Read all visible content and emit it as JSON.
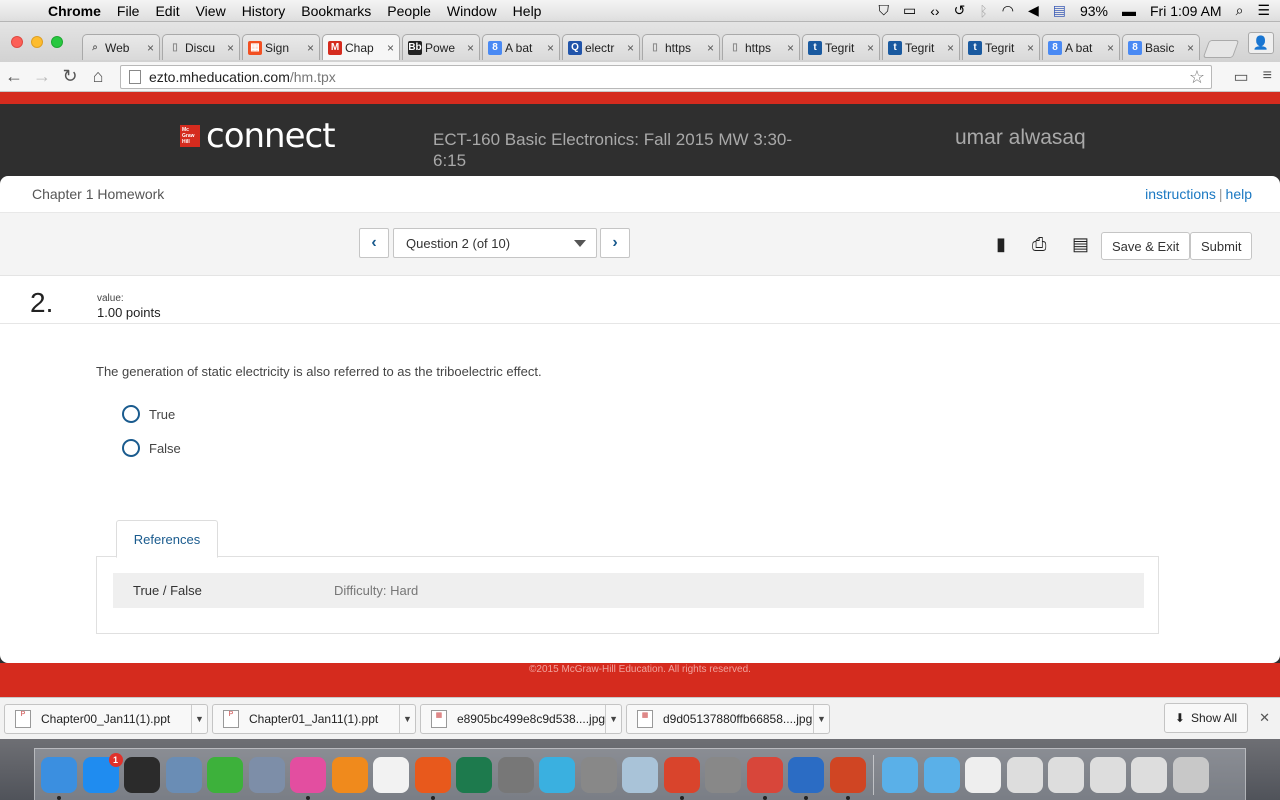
{
  "menubar": {
    "app": "Chrome",
    "items": [
      "File",
      "Edit",
      "View",
      "History",
      "Bookmarks",
      "People",
      "Window",
      "Help"
    ],
    "battery": "93%",
    "clock": "Fri 1:09 AM"
  },
  "tabs": [
    {
      "label": "Web",
      "icon": "search-icon",
      "color": "#666666"
    },
    {
      "label": "Discu",
      "icon": "page-icon",
      "color": "#888888"
    },
    {
      "label": "Sign",
      "icon": "microsoft-icon",
      "color": "#f25022"
    },
    {
      "label": "Chap",
      "icon": "mcgraw-hill-icon",
      "color": "#d52b1e"
    },
    {
      "label": "Powe",
      "icon": "blackboard-icon",
      "color": "#222222"
    },
    {
      "label": "A bat",
      "icon": "google-icon",
      "color": "#4a8af4"
    },
    {
      "label": "electr",
      "icon": "quora-icon",
      "color": "#2255aa"
    },
    {
      "label": "https",
      "icon": "page-icon",
      "color": "#888888"
    },
    {
      "label": "https",
      "icon": "page-icon",
      "color": "#888888"
    },
    {
      "label": "Tegrit",
      "icon": "tegrity-icon",
      "color": "#1a5aa0"
    },
    {
      "label": "Tegrit",
      "icon": "tegrity-icon",
      "color": "#1a5aa0"
    },
    {
      "label": "Tegrit",
      "icon": "tegrity-icon",
      "color": "#1a5aa0"
    },
    {
      "label": "A bat",
      "icon": "google-icon",
      "color": "#4a8af4"
    },
    {
      "label": "Basic",
      "icon": "google-icon",
      "color": "#4a8af4"
    }
  ],
  "active_tab_index": 3,
  "address": {
    "host": "ezto.mheducation.com",
    "path": "/hm.tpx"
  },
  "header": {
    "logo": "connect",
    "course": "ECT-160 Basic Electronics: Fall 2015 MW 3:30-6:15",
    "user": "umar alwasaq"
  },
  "assignment": {
    "title": "Chapter 1 Homework",
    "instructions": "instructions",
    "help": "help",
    "question_selector": "Question 2 (of 10)",
    "save_exit": "Save & Exit",
    "submit": "Submit"
  },
  "question": {
    "number": "2.",
    "value_label": "value:",
    "points": "1.00 points",
    "text": "The generation of static electricity is also referred to as the triboelectric effect.",
    "options": [
      "True",
      "False"
    ]
  },
  "references": {
    "tab": "References",
    "type": "True / False",
    "difficulty": "Difficulty: Hard"
  },
  "footer": "©2015 McGraw-Hill Education. All rights reserved.",
  "downloads": [
    {
      "name": "Chapter00_Jan11(1).ppt"
    },
    {
      "name": "Chapter01_Jan11(1).ppt"
    },
    {
      "name": "e8905bc499e8c9d538....jpg"
    },
    {
      "name": "d9d05137880ffb66858....jpg"
    }
  ],
  "downloads_show_all": "Show All",
  "dock": [
    {
      "name": "finder-icon",
      "color": "#3b8fe0",
      "running": true
    },
    {
      "name": "app-store-icon",
      "color": "#1f8cf0",
      "badge": "1"
    },
    {
      "name": "dashboard-icon",
      "color": "#2b2b2b"
    },
    {
      "name": "preview-icon",
      "color": "#6a8db5"
    },
    {
      "name": "facetime-icon",
      "color": "#3db13b"
    },
    {
      "name": "photo-browser-icon",
      "color": "#7d8ea8"
    },
    {
      "name": "itunes-icon",
      "color": "#e34ea0",
      "running": true
    },
    {
      "name": "ibooks-icon",
      "color": "#f08a1c"
    },
    {
      "name": "photos-icon",
      "color": "#f2f2f2"
    },
    {
      "name": "firefox-icon",
      "color": "#e8591c",
      "running": true
    },
    {
      "name": "time-machine-icon",
      "color": "#1d7a4d"
    },
    {
      "name": "system-preferences-icon",
      "color": "#777777"
    },
    {
      "name": "messenger-icon",
      "color": "#3ab0e0"
    },
    {
      "name": "unknown-app-icon",
      "color": "#888888"
    },
    {
      "name": "image-capture-icon",
      "color": "#a9c3d8"
    },
    {
      "name": "popcorn-icon",
      "color": "#d9442c",
      "running": true
    },
    {
      "name": "unknown-app-icon",
      "color": "#888888"
    },
    {
      "name": "chrome-icon",
      "color": "#d8463a",
      "running": true
    },
    {
      "name": "word-icon",
      "color": "#2b6cc4",
      "running": true
    },
    {
      "name": "powerpoint-icon",
      "color": "#d04523",
      "running": true
    },
    {
      "name": "applications-folder-icon",
      "color": "#5ab0e8"
    },
    {
      "name": "documents-folder-icon",
      "color": "#5ab0e8"
    },
    {
      "name": "document-stack-icon",
      "color": "#eeeeee"
    },
    {
      "name": "file-icon",
      "color": "#dddddd"
    },
    {
      "name": "file-icon",
      "color": "#dddddd"
    },
    {
      "name": "file-icon",
      "color": "#dddddd"
    },
    {
      "name": "file-icon",
      "color": "#dddddd"
    },
    {
      "name": "trash-icon",
      "color": "#c8c8c8"
    }
  ]
}
